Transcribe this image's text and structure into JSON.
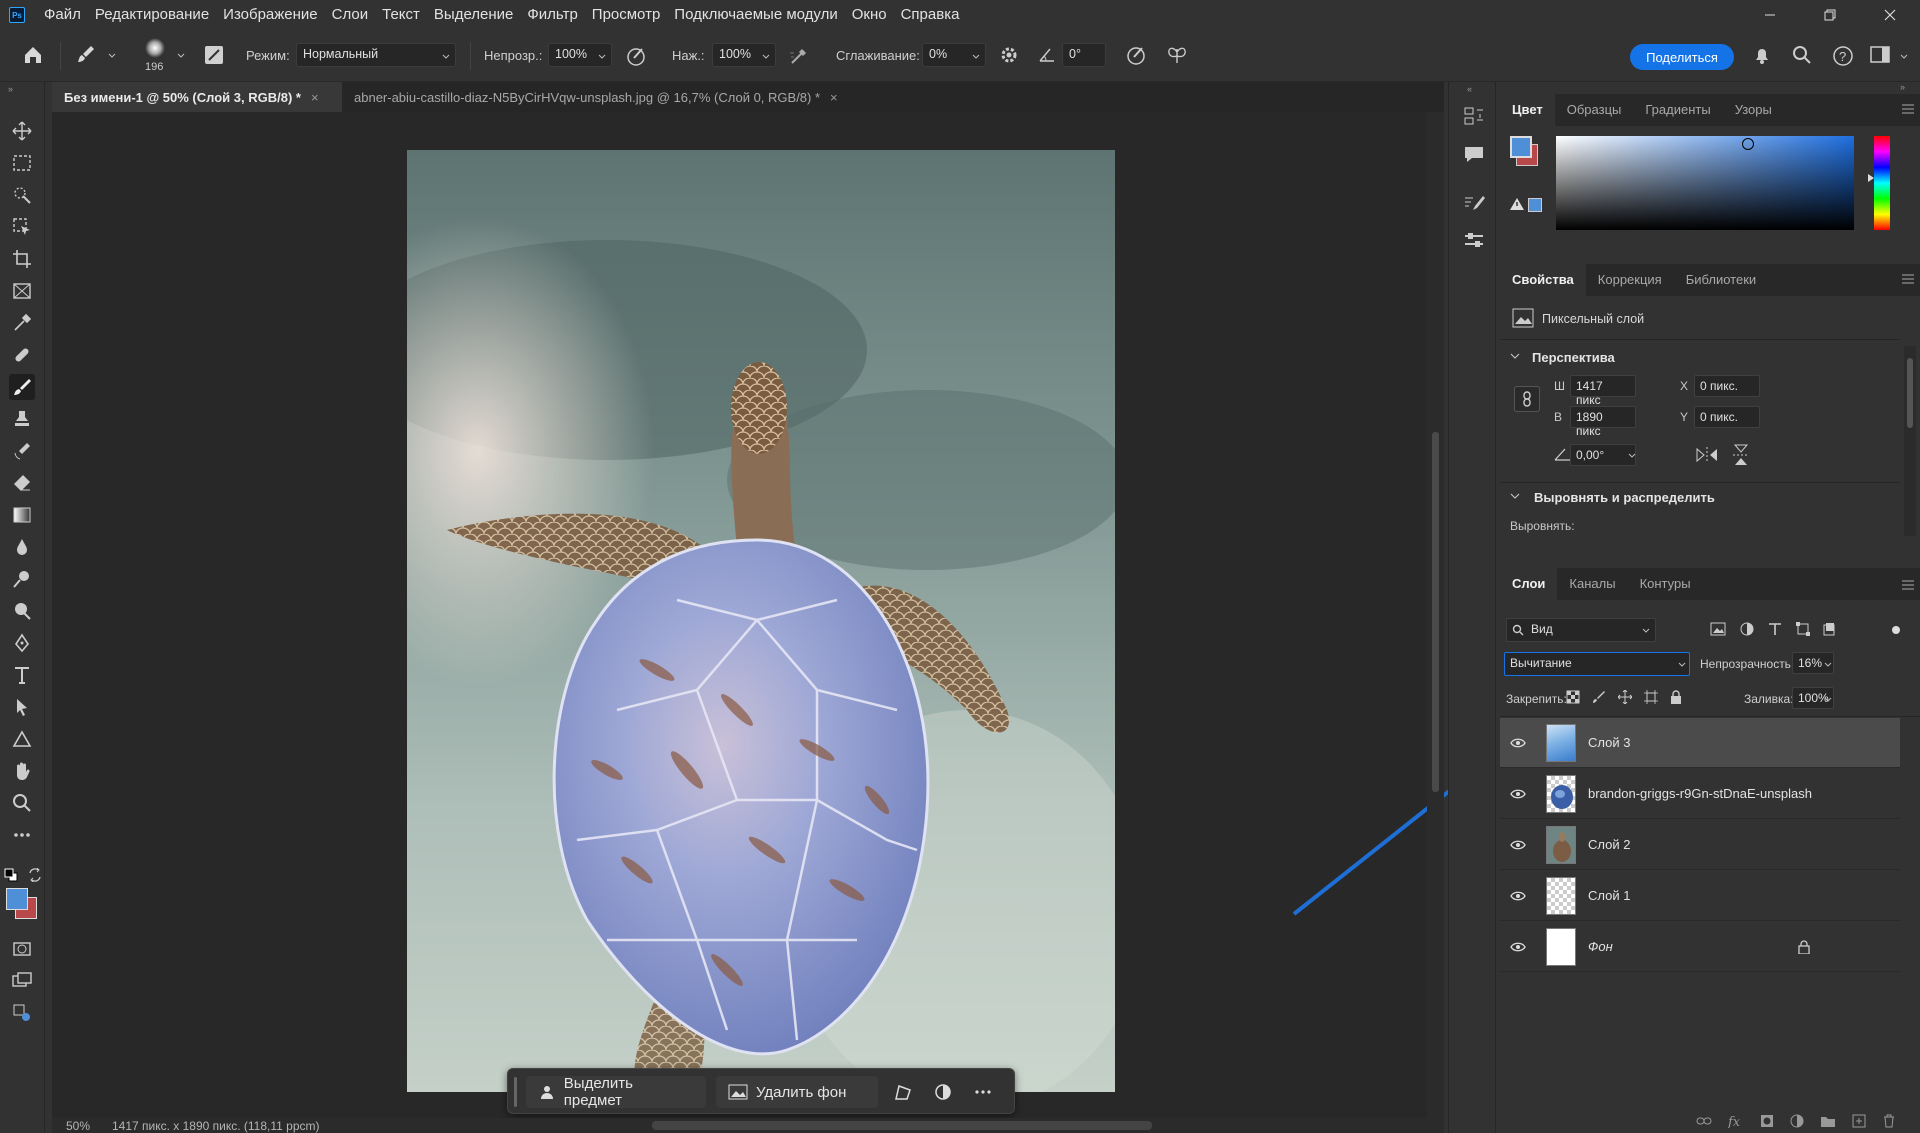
{
  "menu": [
    "Файл",
    "Редактирование",
    "Изображение",
    "Слои",
    "Текст",
    "Выделение",
    "Фильтр",
    "Просмотр",
    "Подключаемые модули",
    "Окно",
    "Справка"
  ],
  "app_logo": "Ps",
  "options": {
    "brush_size": "196",
    "mode_label": "Режим:",
    "mode_value": "Нормальный",
    "opacity_label": "Непрозр.:",
    "opacity_value": "100%",
    "pressure_label": "Наж.:",
    "pressure_value": "100%",
    "smoothing_label": "Сглаживание:",
    "smoothing_value": "0%",
    "angle_value": "0°",
    "share_label": "Поделиться"
  },
  "tabs": [
    {
      "label": "Без имени-1 @ 50% (Слой 3, RGB/8) *",
      "close": "×"
    },
    {
      "label": "abner-abiu-castillo-diaz-N5ByCirHVqw-unsplash.jpg @ 16,7% (Слой 0, RGB/8) *",
      "close": "×"
    }
  ],
  "context_bar": {
    "select_subject": "Выделить предмет",
    "remove_bg": "Удалить фон"
  },
  "status": {
    "zoom": "50%",
    "doc_info": "1417 пикс. x 1890 пикс. (118,11 ppcm)"
  },
  "color_panel": {
    "tabs": [
      "Цвет",
      "Образцы",
      "Градиенты",
      "Узоры"
    ],
    "foreground": "#4f8fd8",
    "background": "#b9484a"
  },
  "properties_panel": {
    "tabs": [
      "Свойства",
      "Коррекция",
      "Библиотеки"
    ],
    "layer_type": "Пиксельный слой",
    "perspective_title": "Перспектива",
    "w_label": "Ш",
    "w_value": "1417 пикс",
    "h_label": "В",
    "h_value": "1890 пикс",
    "x_label": "X",
    "x_value": "0 пикс.",
    "y_label": "Y",
    "y_value": "0 пикс.",
    "angle_value": "0,00°",
    "align_title": "Выровнять и распределить",
    "align_label": "Выровнять:"
  },
  "layers_panel": {
    "tabs": [
      "Слои",
      "Каналы",
      "Контуры"
    ],
    "filter_kind": "Вид",
    "blend_mode": "Вычитание",
    "opacity_label": "Непрозрачность:",
    "opacity_value": "16%",
    "lock_label": "Закрепить:",
    "fill_label": "Заливка:",
    "fill_value": "100%",
    "layers": [
      {
        "name": "Слой 3",
        "selected": true,
        "thumb": "sky"
      },
      {
        "name": "brandon-griggs-r9Gn-stDnaE-unsplash",
        "selected": false,
        "thumb": "ball"
      },
      {
        "name": "Слой 2",
        "selected": false,
        "thumb": "turtle"
      },
      {
        "name": "Слой 1",
        "selected": false,
        "thumb": "transparent"
      },
      {
        "name": "Фон",
        "selected": false,
        "thumb": "white",
        "locked": true
      }
    ]
  },
  "accent_colors": {
    "selection_blue": "#1473e6",
    "annotation_arrow": "#1d6fd6"
  }
}
